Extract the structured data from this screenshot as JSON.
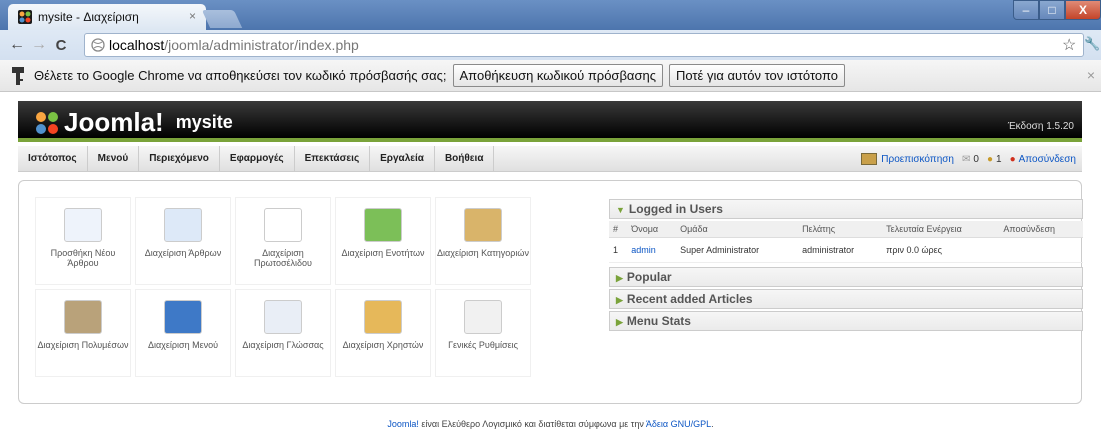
{
  "browser": {
    "tab_title": "mysite - Διαχείριση",
    "tab_close": "×",
    "url_host": "localhost",
    "url_path": "/joomla/administrator/index.php",
    "back": "←",
    "forward": "→",
    "reload": "C",
    "star": "☆",
    "wrench": "🔧",
    "min": "–",
    "max": "□",
    "close": "X"
  },
  "infobar": {
    "message": "Θέλετε το Google Chrome να αποθηκεύσει τον κωδικό πρόσβασής σας;",
    "save_button": "Αποθήκευση κωδικού πρόσβασης",
    "never_button": "Ποτέ για αυτόν τον ιστότοπο",
    "close": "×"
  },
  "joomla": {
    "logo": "Joomla!",
    "site_name": "mysite",
    "version": "Έκδοση 1.5.20",
    "menu": [
      "Ιστότοπος",
      "Μενού",
      "Περιεχόμενο",
      "Εφαρμογές",
      "Επεκτάσεις",
      "Εργαλεία",
      "Βοήθεια"
    ],
    "right": {
      "preview": "Προεπισκόπηση",
      "messages": "0",
      "users": "1",
      "logout": "Αποσύνδεση"
    },
    "icons": [
      {
        "label": "Προσθήκη Νέου Άρθρου"
      },
      {
        "label": "Διαχείριση Άρθρων"
      },
      {
        "label": "Διαχείριση Πρωτοσέλιδου"
      },
      {
        "label": "Διαχείριση Ενοτήτων"
      },
      {
        "label": "Διαχείριση Κατηγοριών"
      },
      {
        "label": "Διαχείριση Πολυμέσων"
      },
      {
        "label": "Διαχείριση Μενού"
      },
      {
        "label": "Διαχείριση Γλώσσας"
      },
      {
        "label": "Διαχείριση Χρηστών"
      },
      {
        "label": "Γενικές Ρυθμίσεις"
      }
    ],
    "modules": {
      "logged_in": {
        "title": "Logged in Users",
        "columns": [
          "#",
          "Όνομα",
          "Ομάδα",
          "Πελάτης",
          "Τελευταία Ενέργεια",
          "Αποσύνδεση"
        ],
        "rows": [
          [
            "1",
            "admin",
            "Super Administrator",
            "administrator",
            "πριν 0.0 ώρες",
            ""
          ]
        ]
      },
      "popular": "Popular",
      "recent": "Recent added Articles",
      "menu_stats": "Menu Stats"
    },
    "footer": {
      "joomla": "Joomla!",
      "text": " είναι Ελεύθερο Λογισμικό και διατίθεται σύμφωνα με την ",
      "license": "Άδεια GNU/GPL",
      "dot": "."
    }
  }
}
